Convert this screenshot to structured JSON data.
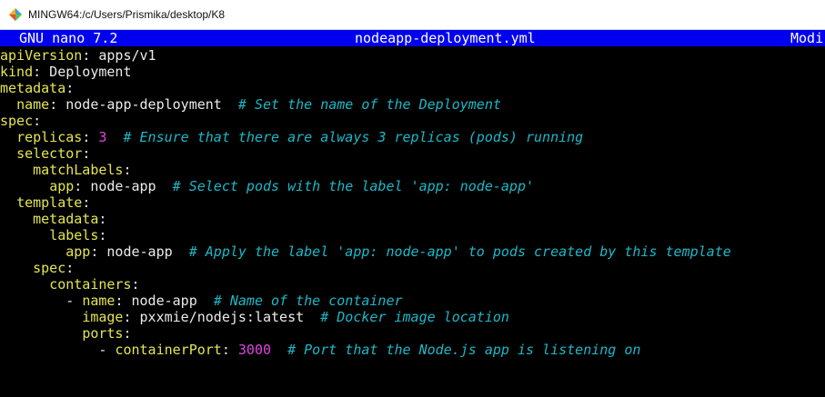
{
  "window": {
    "title": "MINGW64:/c/Users/Prismika/desktop/K8"
  },
  "nano": {
    "version": "GNU nano 7.2",
    "filename": "nodeapp-deployment.yml",
    "status": "Modi"
  },
  "colors": {
    "header_bg": "#0000ee",
    "key": "#e5e553",
    "value": "#ebebeb",
    "number": "#e045e0",
    "comment": "#1cb8c8"
  },
  "lines": [
    {
      "indent": "",
      "key": "apiVersion",
      "value": " apps/v1",
      "number": "",
      "comment": ""
    },
    {
      "indent": "",
      "key": "kind",
      "value": " Deployment",
      "number": "",
      "comment": ""
    },
    {
      "indent": "",
      "key": "metadata",
      "value": "",
      "number": "",
      "comment": ""
    },
    {
      "indent": "  ",
      "key": "name",
      "value": " node-app-deployment  ",
      "number": "",
      "comment": "# Set the name of the Deployment"
    },
    {
      "indent": "",
      "key": "spec",
      "value": "",
      "number": "",
      "comment": ""
    },
    {
      "indent": "  ",
      "key": "replicas",
      "value": " ",
      "number": "3",
      "comment": "  # Ensure that there are always 3 replicas (pods) running"
    },
    {
      "indent": "  ",
      "key": "selector",
      "value": "",
      "number": "",
      "comment": ""
    },
    {
      "indent": "    ",
      "key": "matchLabels",
      "value": "",
      "number": "",
      "comment": ""
    },
    {
      "indent": "      ",
      "key": "app",
      "value": " node-app  ",
      "number": "",
      "comment": "# Select pods with the label 'app: node-app'"
    },
    {
      "indent": "  ",
      "key": "template",
      "value": "",
      "number": "",
      "comment": ""
    },
    {
      "indent": "    ",
      "key": "metadata",
      "value": "",
      "number": "",
      "comment": ""
    },
    {
      "indent": "      ",
      "key": "labels",
      "value": "",
      "number": "",
      "comment": ""
    },
    {
      "indent": "        ",
      "key": "app",
      "value": " node-app  ",
      "number": "",
      "comment": "# Apply the label 'app: node-app' to pods created by this template"
    },
    {
      "indent": "    ",
      "key": "spec",
      "value": "",
      "number": "",
      "comment": ""
    },
    {
      "indent": "      ",
      "key": "containers",
      "value": "",
      "number": "",
      "comment": ""
    },
    {
      "indent": "        - ",
      "key": "name",
      "value": " node-app  ",
      "number": "",
      "comment": "# Name of the container"
    },
    {
      "indent": "          ",
      "key": "image",
      "value": " pxxmie/nodejs:latest  ",
      "number": "",
      "comment": "# Docker image location"
    },
    {
      "indent": "          ",
      "key": "ports",
      "value": "",
      "number": "",
      "comment": ""
    },
    {
      "indent": "            - ",
      "key": "containerPort",
      "value": " ",
      "number": "3000",
      "comment": "  # Port that the Node.js app is listening on"
    }
  ]
}
